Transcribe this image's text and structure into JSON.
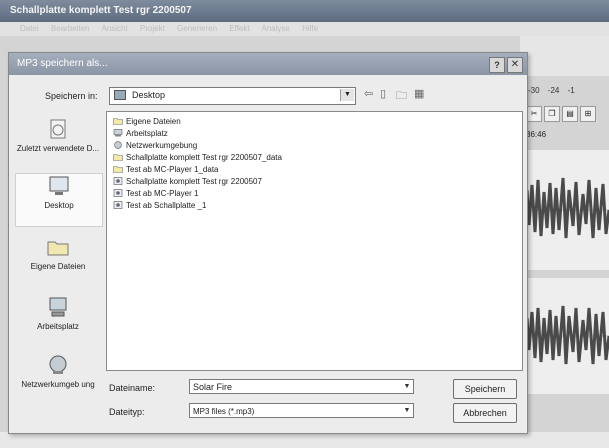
{
  "app": {
    "title": "Schallplatte komplett Test rgr 2200507",
    "menu": [
      "Datei",
      "Bearbeiten",
      "Ansicht",
      "Projekt",
      "Generieren",
      "Effekt",
      "Analyse",
      "Hilfe"
    ],
    "db_scale": [
      "-30",
      "-24",
      "-1"
    ],
    "timecode": "36:46"
  },
  "dialog": {
    "title": "MP3 speichern als...",
    "help": "?",
    "close": "✕",
    "look_in_label": "Speichern in:",
    "look_in_value": "Desktop",
    "places": [
      {
        "label": "Zuletzt verwendete D...",
        "icon": "recent-docs-icon"
      },
      {
        "label": "Desktop",
        "icon": "desktop-icon"
      },
      {
        "label": "Eigene Dateien",
        "icon": "my-documents-icon"
      },
      {
        "label": "Arbeitsplatz",
        "icon": "my-computer-icon"
      },
      {
        "label": "Netzwerkumgeb ung",
        "icon": "network-icon"
      }
    ],
    "files": [
      {
        "name": "Eigene Dateien",
        "icon": "folder-icon"
      },
      {
        "name": "Arbeitsplatz",
        "icon": "computer-small-icon"
      },
      {
        "name": "Netzwerkumgebung",
        "icon": "network-small-icon"
      },
      {
        "name": "Schallplatte komplett Test rgr 2200507_data",
        "icon": "folder-icon"
      },
      {
        "name": "Test ab MC-Player 1_data",
        "icon": "folder-icon"
      },
      {
        "name": "Schallplatte komplett Test rgr 2200507",
        "icon": "audio-file-icon"
      },
      {
        "name": "Test ab MC-Player 1",
        "icon": "audio-file-icon"
      },
      {
        "name": "Test ab Schallplatte _1",
        "icon": "audio-file-icon"
      }
    ],
    "filename_label": "Dateiname:",
    "filename_value": "Solar Fire",
    "filetype_label": "Dateityp:",
    "filetype_value": "MP3 files (*.mp3)",
    "save_button": "Speichern",
    "cancel_button": "Abbrechen"
  }
}
